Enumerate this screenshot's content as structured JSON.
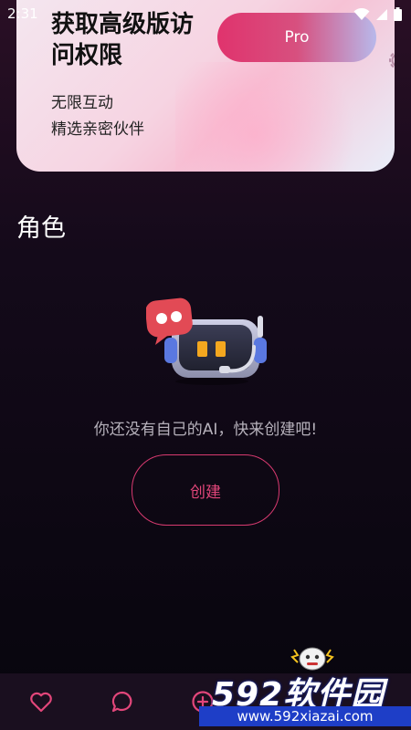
{
  "status_bar": {
    "time": "2:31"
  },
  "promo": {
    "title": "获取高级版访问权限",
    "pro_label": "Pro",
    "benefits": [
      "无限互动",
      "精选亲密伙伴"
    ]
  },
  "section": {
    "title": "角色"
  },
  "empty_state": {
    "message": "你还没有自己的AI，快来创建吧!",
    "create_label": "创建"
  },
  "tabbar": {
    "icons": [
      "heart-icon",
      "chat-bubble-icon",
      "add-circle-icon"
    ]
  },
  "watermark": {
    "logo": "592软件园",
    "url": "www.592xiazai.com"
  },
  "colors": {
    "accent": "#e0336d",
    "background": "#07050d",
    "promo_bg": "#f6d4e2",
    "tabbar_bg": "#1a0f1f",
    "watermark_blue": "#1e3ec7"
  }
}
